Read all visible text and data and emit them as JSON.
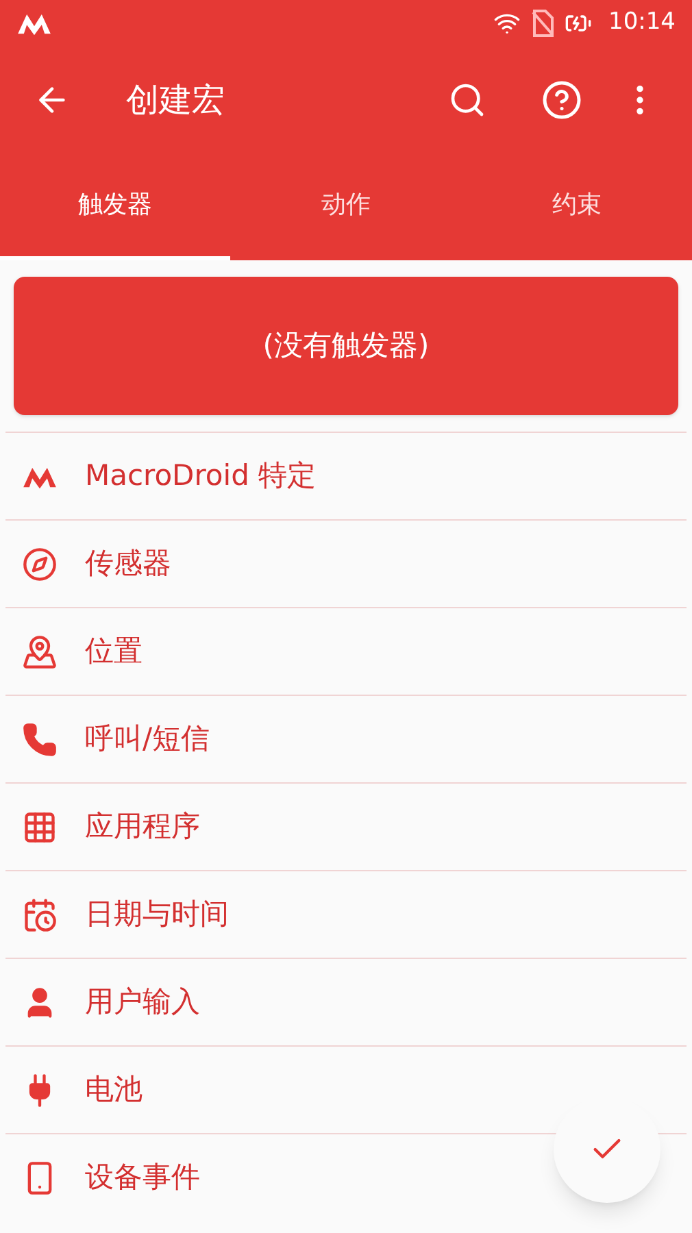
{
  "status_bar": {
    "time": "10:14"
  },
  "app_bar": {
    "title": "创建宏"
  },
  "tabs": [
    {
      "label": "触发器",
      "selected": true
    },
    {
      "label": "动作",
      "selected": false
    },
    {
      "label": "约束",
      "selected": false
    }
  ],
  "empty_card": {
    "text": "(没有触发器)"
  },
  "categories": [
    {
      "kind": "logo",
      "label": "MacroDroid 特定"
    },
    {
      "kind": "compass",
      "label": "传感器"
    },
    {
      "kind": "map",
      "label": "位置"
    },
    {
      "kind": "phone",
      "label": "呼叫/短信"
    },
    {
      "kind": "grid",
      "label": "应用程序"
    },
    {
      "kind": "calendar",
      "label": "日期与时间"
    },
    {
      "kind": "person",
      "label": "用户输入"
    },
    {
      "kind": "plug",
      "label": "电池"
    },
    {
      "kind": "device",
      "label": "设备事件"
    }
  ]
}
